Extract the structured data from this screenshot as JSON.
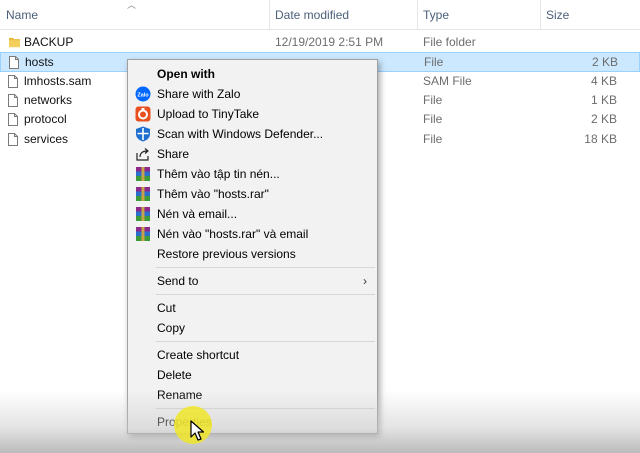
{
  "columns": {
    "name": "Name",
    "date": "Date modified",
    "type": "Type",
    "size": "Size"
  },
  "files": [
    {
      "name": "BACKUP",
      "date": "12/19/2019 2:51 PM",
      "type": "File folder",
      "size": "",
      "icon": "folder-icon"
    },
    {
      "name": "hosts",
      "date": "",
      "type": "File",
      "size": "2 KB",
      "icon": "file-icon"
    },
    {
      "name": "lmhosts.sam",
      "date": "",
      "type": "SAM File",
      "size": "4 KB",
      "icon": "file-icon"
    },
    {
      "name": "networks",
      "date": "",
      "type": "File",
      "size": "1 KB",
      "icon": "file-icon"
    },
    {
      "name": "protocol",
      "date": "",
      "type": "File",
      "size": "2 KB",
      "icon": "file-icon"
    },
    {
      "name": "services",
      "date": "",
      "type": "File",
      "size": "18 KB",
      "icon": "file-icon"
    }
  ],
  "context_menu": {
    "open_with": "Open with",
    "share_zalo": "Share with Zalo",
    "upload_tinytake": "Upload to TinyTake",
    "scan_defender": "Scan with Windows Defender...",
    "share": "Share",
    "add_archive": "Thêm vào tập tin nén...",
    "add_hosts_rar": "Thêm vào \"hosts.rar\"",
    "compress_email": "Nén và email...",
    "compress_rar_email": "Nén vào \"hosts.rar\" và email",
    "restore": "Restore previous versions",
    "send_to": "Send to",
    "cut": "Cut",
    "copy": "Copy",
    "create_shortcut": "Create shortcut",
    "delete": "Delete",
    "rename": "Rename",
    "properties": "Properties"
  },
  "colors": {
    "selection": "#cce8ff",
    "menu_bg": "#f2f2f2",
    "folder": "#e8b93c",
    "zalo": "#0068ff",
    "tinytake": "#e8501f",
    "defender": "#1f6fd1",
    "cursor_halo": "#f0e628"
  }
}
